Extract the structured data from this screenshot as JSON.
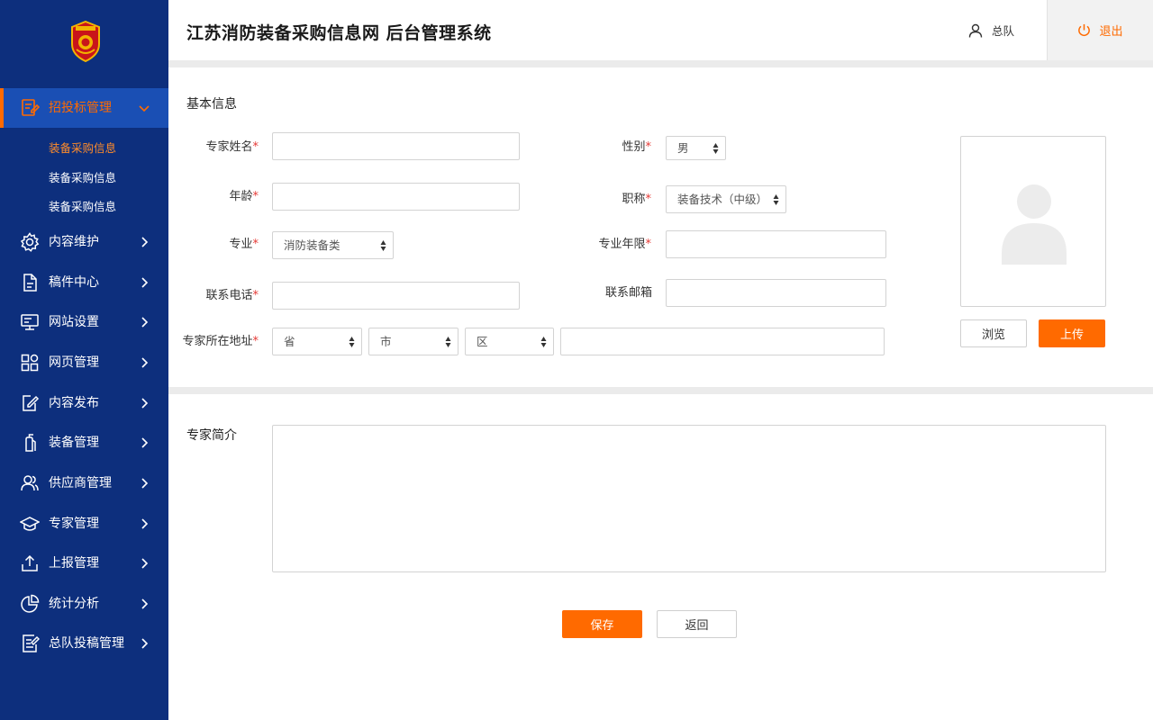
{
  "header": {
    "title": "江苏消防装备采购信息网  后台管理系统",
    "user_name": "总队",
    "logout_label": "退出"
  },
  "colors": {
    "sidebar": "#0d2f7d",
    "accent": "#ff6a00",
    "active_bg": "#1a4fb4"
  },
  "sidebar": {
    "active_menu": {
      "label": "招投标管理",
      "icon": "bidding-doc-icon",
      "subitems": [
        "装备采购信息",
        "装备采购信息",
        "装备采购信息"
      ]
    },
    "items": [
      {
        "label": "内容维护",
        "icon": "gear-icon"
      },
      {
        "label": "稿件中心",
        "icon": "document-icon"
      },
      {
        "label": "网站设置",
        "icon": "monitor-icon"
      },
      {
        "label": "网页管理",
        "icon": "grid-icon"
      },
      {
        "label": "内容发布",
        "icon": "edit-icon"
      },
      {
        "label": "装备管理",
        "icon": "extinguisher-icon"
      },
      {
        "label": "供应商管理",
        "icon": "users-icon"
      },
      {
        "label": "专家管理",
        "icon": "graduation-cap-icon"
      },
      {
        "label": "上报管理",
        "icon": "upload-icon"
      },
      {
        "label": "统计分析",
        "icon": "pie-chart-icon"
      },
      {
        "label": "总队投稿管理",
        "icon": "notes-icon"
      }
    ]
  },
  "form": {
    "section_basic": "基本信息",
    "labels": {
      "name": "专家姓名",
      "gender": "性别",
      "age": "年龄",
      "title": "职称",
      "major": "专业",
      "years": "专业年限",
      "phone": "联系电话",
      "email": "联系邮箱",
      "address": "专家所在地址"
    },
    "required_mark": "*",
    "gender_value": "男",
    "title_value": "装备技术（中级）",
    "major_value": "消防装备类",
    "province_value": "省",
    "city_value": "市",
    "district_value": "区",
    "browse_label": "浏览",
    "upload_label": "上传",
    "intro_label": "专家简介",
    "save_label": "保存",
    "back_label": "返回"
  }
}
